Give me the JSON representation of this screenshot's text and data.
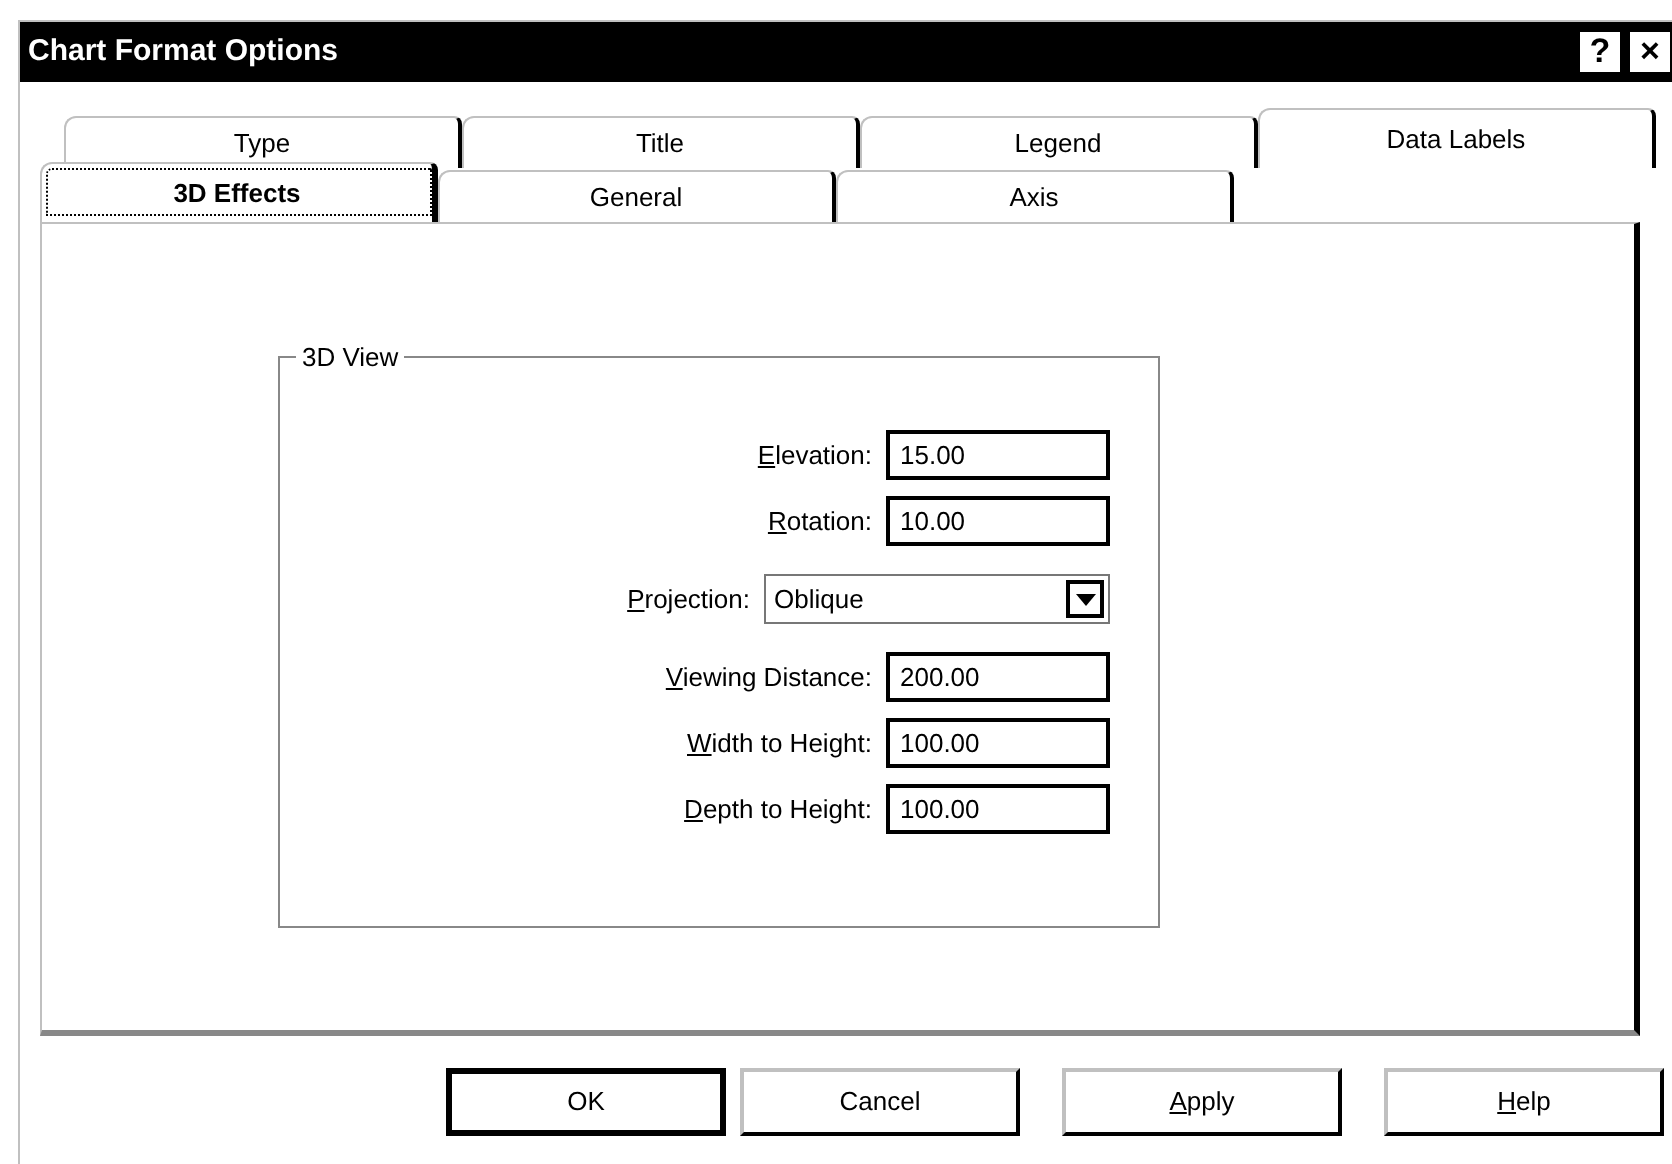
{
  "window": {
    "title": "Chart Format Options",
    "title_buttons": [
      "?",
      "×"
    ]
  },
  "tab_rows": [
    {
      "tabs": [
        {
          "label": "Type",
          "selected": false
        },
        {
          "label": "Title",
          "selected": false
        },
        {
          "label": "Legend",
          "selected": false
        },
        {
          "label": "Data Labels",
          "selected": false
        }
      ]
    },
    {
      "tabs": [
        {
          "label": "3D Effects",
          "selected": true
        },
        {
          "label": "General",
          "selected": false
        },
        {
          "label": "Axis",
          "selected": false
        }
      ]
    }
  ],
  "group": {
    "title": "3D View",
    "field_sets": [
      [
        {
          "kind": "text",
          "label": "Elevation:",
          "access_key": true,
          "value": "15.00"
        },
        {
          "kind": "text",
          "label": "Rotation:",
          "access_key": true,
          "value": "10.00"
        }
      ],
      [
        {
          "kind": "dropdown",
          "label": "Projection:",
          "access_key": true,
          "value": "Oblique"
        }
      ],
      [
        {
          "kind": "text",
          "label": "Viewing Distance:",
          "access_key": true,
          "value": "200.00"
        },
        {
          "kind": "text",
          "label": "Width to Height:",
          "access_key": true,
          "value": "100.00"
        },
        {
          "kind": "text",
          "label": "Depth to Height:",
          "access_key": true,
          "value": "100.00"
        }
      ]
    ]
  },
  "buttons": [
    {
      "label": "OK",
      "default": true,
      "access_key": false
    },
    {
      "label": "Cancel",
      "default": false,
      "access_key": false
    },
    {
      "label": "Apply",
      "default": false,
      "access_key": true
    },
    {
      "label": "Help",
      "default": false,
      "access_key": true
    }
  ]
}
